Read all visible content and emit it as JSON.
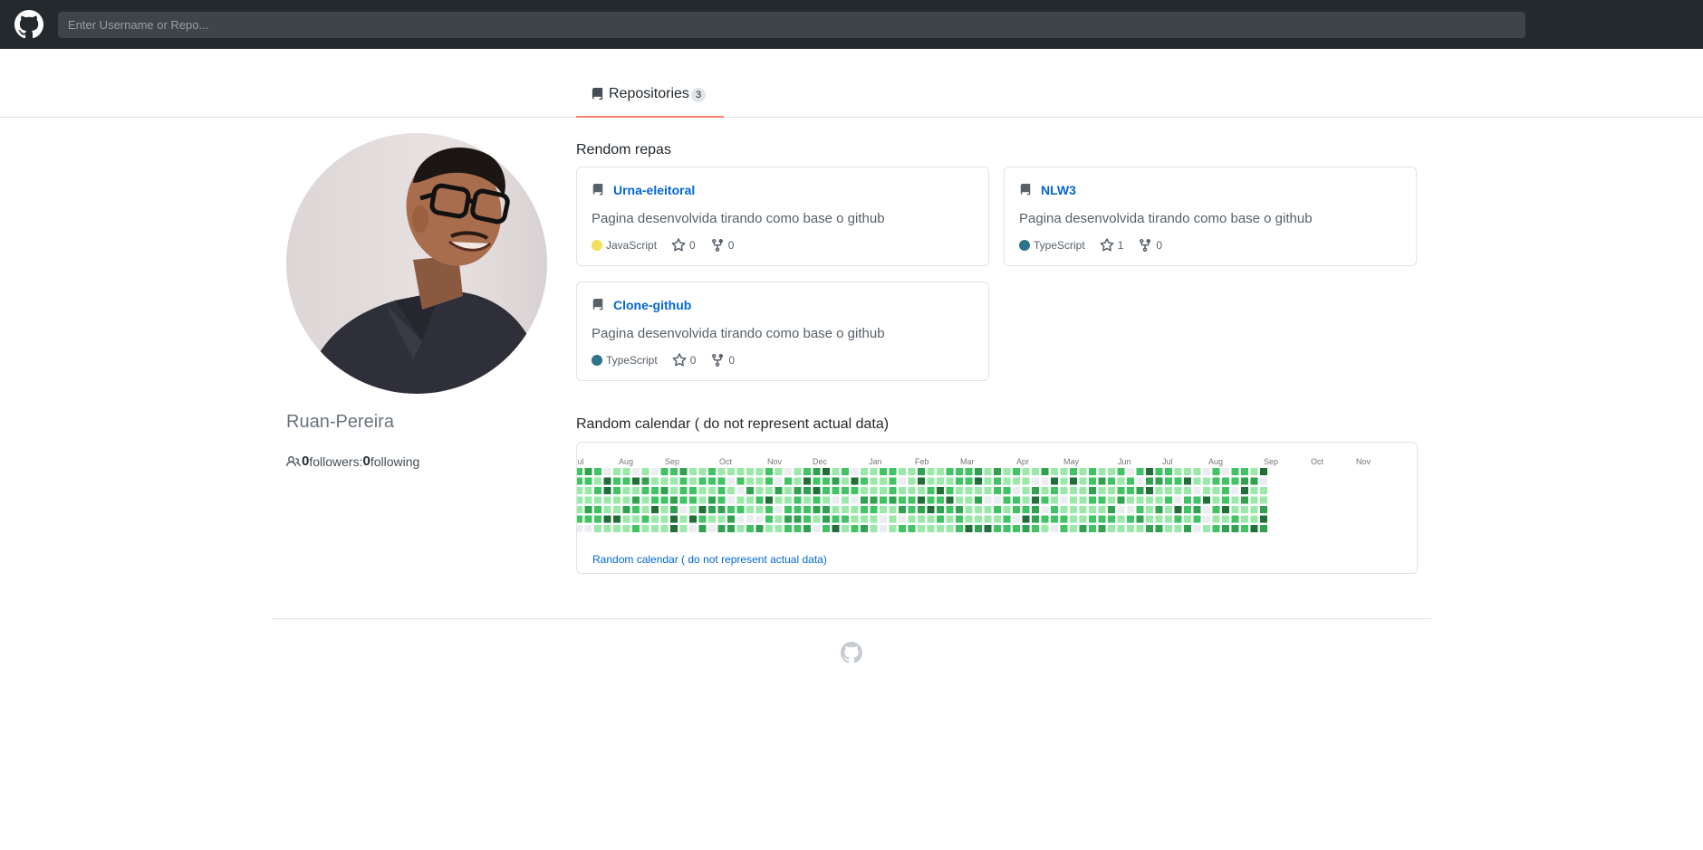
{
  "search": {
    "placeholder": "Enter Username or Repo..."
  },
  "tabs": [
    {
      "label": "Repositories",
      "count": "3"
    }
  ],
  "profile": {
    "username": "Ruan-Pereira",
    "followers": "0",
    "followers_label": "followers",
    "separator": ":",
    "following": "0",
    "following_label": "following"
  },
  "sections": {
    "repos_title": "Rendom repas",
    "calendar_title": "Random calendar ( do not represent actual data)"
  },
  "repos": [
    {
      "name": "Urna-eleitoral",
      "description": "Pagina desenvolvida tirando como base o github",
      "language": "JavaScript",
      "language_color": "#f1e05a",
      "stars": "0",
      "forks": "0"
    },
    {
      "name": "NLW3",
      "description": "Pagina desenvolvida tirando como base o github",
      "language": "TypeScript",
      "language_color": "#2b7489",
      "stars": "1",
      "forks": "0"
    },
    {
      "name": "Clone-github",
      "description": "Pagina desenvolvida tirando como base o github",
      "language": "TypeScript",
      "language_color": "#2b7489",
      "stars": "0",
      "forks": "0"
    }
  ],
  "calendar": {
    "months": [
      "Jul",
      "Aug",
      "Sep",
      "Oct",
      "Nov",
      "Dec",
      "Jan",
      "Feb",
      "Mar",
      "Apr",
      "May",
      "Jun",
      "Jul",
      "Aug",
      "Sep",
      "Oct",
      "Nov"
    ],
    "link_text": "Random calendar ( do not represent actual data)",
    "colors": [
      "#ebedf0",
      "#9be9a8",
      "#40c463",
      "#30a14e",
      "#216e39"
    ]
  }
}
